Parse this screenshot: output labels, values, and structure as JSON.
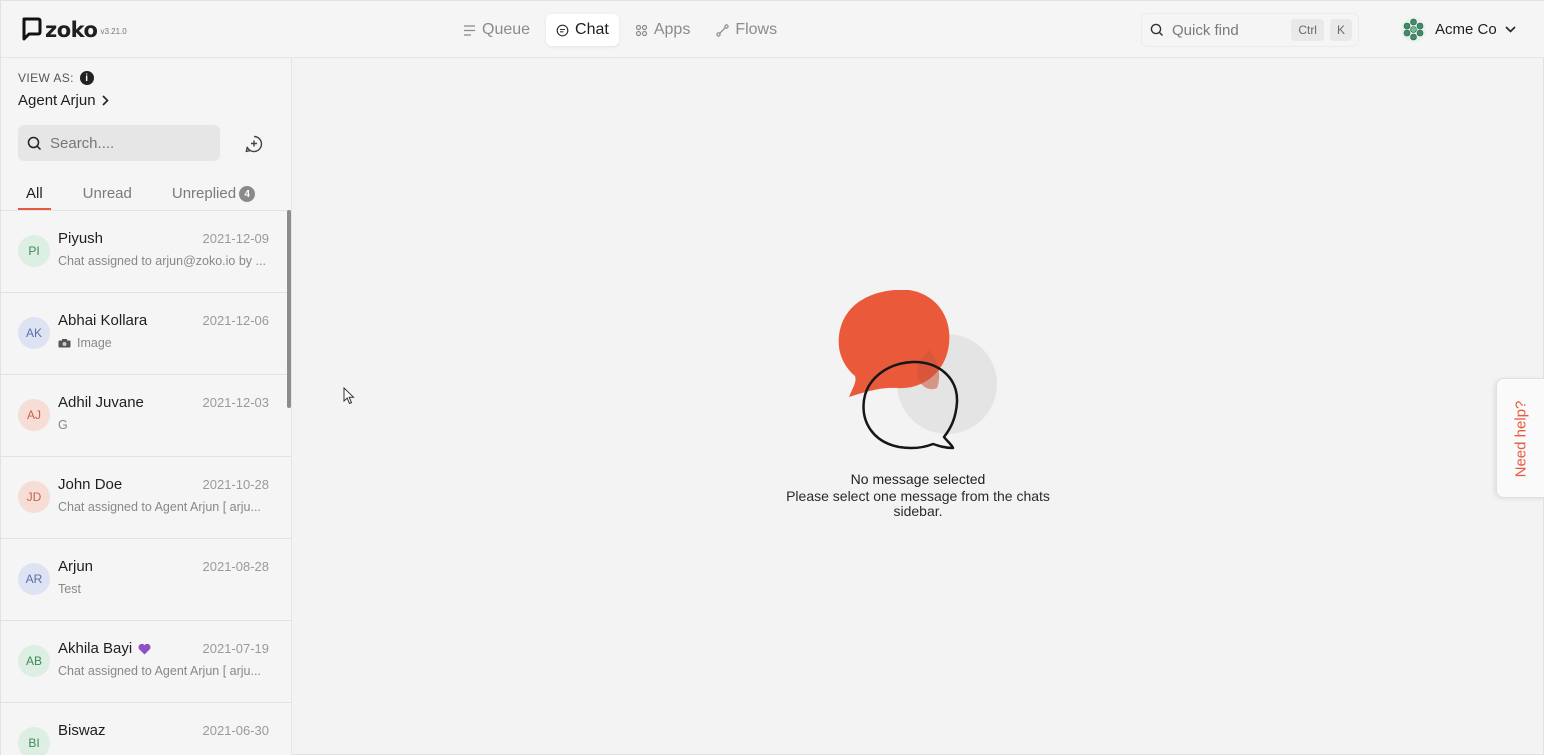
{
  "app": {
    "brand": "zoko",
    "version": "v3.21.0"
  },
  "nav": {
    "items": [
      {
        "label": "Queue",
        "icon": "queue-icon"
      },
      {
        "label": "Chat",
        "icon": "chat-icon",
        "active": true
      },
      {
        "label": "Apps",
        "icon": "apps-icon"
      },
      {
        "label": "Flows",
        "icon": "flows-icon"
      }
    ]
  },
  "quickfind": {
    "label": "Quick find",
    "shortcut": [
      "Ctrl",
      "K"
    ]
  },
  "org": {
    "name": "Acme Co"
  },
  "sidebar": {
    "view_as_label": "VIEW AS:",
    "agent": "Agent Arjun",
    "search_placeholder": "Search....",
    "tabs": [
      {
        "label": "All",
        "active": true
      },
      {
        "label": "Unread"
      },
      {
        "label": "Unreplied",
        "count": "4"
      }
    ],
    "chats": [
      {
        "initials": "PI",
        "name": "Piyush",
        "date": "2021-12-09",
        "preview": "Chat assigned to arjun@zoko.io by ...",
        "avatar_bg": "#ddeee3",
        "avatar_fg": "#3f8a57"
      },
      {
        "initials": "AK",
        "name": "Abhai Kollara",
        "date": "2021-12-06",
        "preview": "Image",
        "preview_icon": "camera-icon",
        "avatar_bg": "#dde3f2",
        "avatar_fg": "#5a6fa8"
      },
      {
        "initials": "AJ",
        "name": "Adhil Juvane",
        "date": "2021-12-03",
        "preview": "G",
        "avatar_bg": "#f6ddd6",
        "avatar_fg": "#c9634a"
      },
      {
        "initials": "JD",
        "name": "John Doe",
        "date": "2021-10-28",
        "preview": "Chat assigned to Agent Arjun [ arju...",
        "avatar_bg": "#f6ddd6",
        "avatar_fg": "#c9634a"
      },
      {
        "initials": "AR",
        "name": "Arjun",
        "date": "2021-08-28",
        "preview": "Test",
        "avatar_bg": "#dde3f2",
        "avatar_fg": "#5a6fa8"
      },
      {
        "initials": "AB",
        "name": "Akhila Bayi",
        "name_icon": "purple-heart-icon",
        "date": "2021-07-19",
        "preview": "Chat assigned to Agent Arjun [ arju...",
        "avatar_bg": "#ddeee3",
        "avatar_fg": "#3f8a57"
      },
      {
        "initials": "BI",
        "name": "Biswaz",
        "date": "2021-06-30",
        "preview": "",
        "avatar_bg": "#ddeee3",
        "avatar_fg": "#3f8a57"
      }
    ]
  },
  "main": {
    "empty_title": "No message selected",
    "empty_subtitle": "Please select one message from the chats sidebar."
  },
  "help": {
    "label": "Need help?"
  },
  "colors": {
    "accent": "#e85a3f",
    "heart": "#8e4fc9"
  }
}
